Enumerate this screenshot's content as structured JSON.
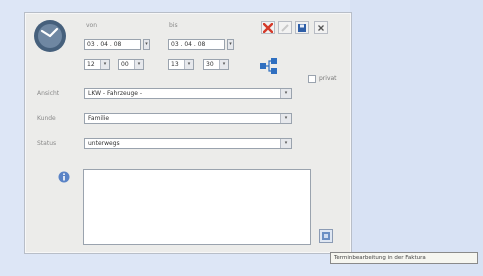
{
  "dialog": {
    "from_label": "von",
    "to_label": "bis",
    "from_date": "03 . 04 . 08",
    "to_date": "03 . 04 . 08",
    "from_hour": "12",
    "from_minute": "00",
    "to_hour": "13",
    "to_minute": "30",
    "private_label": "privat",
    "fields": {
      "art_label": "Ansicht",
      "art_value": "LKW - Fahrzeuge -",
      "kunde_label": "Kunde",
      "kunde_value": "Familie",
      "status_label": "Status",
      "status_value": "unterwegs"
    }
  },
  "tooltip": "Terminbearbeitung in der Faktura",
  "colors": {
    "delete_icon": "#d43a2a",
    "save_icon": "#2f5fa8",
    "link_icon": "#2f6fc0",
    "window_bg": "#ececea",
    "page_bg": "#dde6f6"
  },
  "icons": [
    "clock-icon",
    "delete-icon",
    "edit-icon",
    "save-icon",
    "close-icon",
    "network-icon",
    "info-icon",
    "faktura-icon"
  ]
}
